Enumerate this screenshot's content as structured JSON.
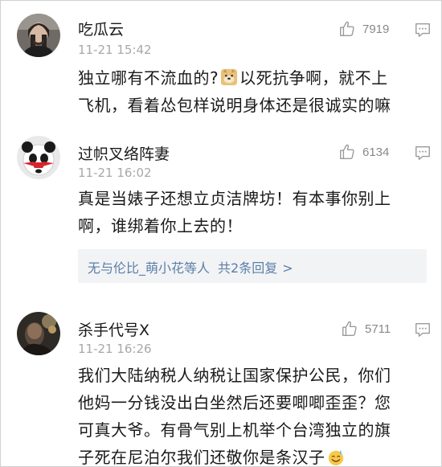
{
  "comments": [
    {
      "username": "吃瓜云",
      "time": "11-21 15:42",
      "likes": "7919",
      "avatar_icon": "man-portrait-avatar",
      "lines": [
        "独立哪有不流血的?",
        "以死抗争啊，就不上",
        "飞机，看着怂包样说明身体还是很诚实的嘛"
      ]
    },
    {
      "username": "过帜叉络阵妻",
      "time": "11-21 16:02",
      "likes": "6134",
      "avatar_icon": "cartoon-panda-avatar",
      "lines": [
        "真是当婊子还想立贞洁牌坊！有本事你别上",
        "啊，谁绑着你上去的！"
      ],
      "replies": {
        "names": "无与伦比_萌小花",
        "suffix": "等人",
        "count": "共2条回复",
        "arrow": ">"
      }
    },
    {
      "username": "杀手代号X",
      "time": "11-21 16:26",
      "likes": "5711",
      "avatar_icon": "dark-photo-avatar",
      "lines": [
        "我们大陆纳税人纳税让国家保护公民，你们",
        "他妈一分钱没出白坐然后还要唧唧歪歪？您",
        "可真大爷。有骨气别上机举个台湾独立的旗",
        "子死在尼泊尔我们还敬你是条汉子"
      ]
    }
  ],
  "colors": {
    "text": "#1a1a1a",
    "meta": "#a8a8a8",
    "link": "#5b7fa8",
    "reply_bg": "#f2f3f5"
  }
}
